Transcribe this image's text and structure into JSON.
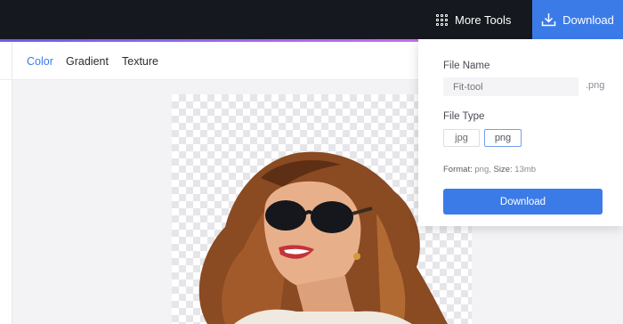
{
  "header": {
    "more_tools_label": "More Tools",
    "download_label": "Download",
    "accent_color": "#3b7be8",
    "dark_color": "#16181f"
  },
  "tabs": [
    {
      "label": "Color",
      "active": true
    },
    {
      "label": "Gradient",
      "active": false
    },
    {
      "label": "Texture",
      "active": false
    }
  ],
  "download_panel": {
    "file_name_label": "File Name",
    "file_name_placeholder": "Fit-tool",
    "extension": ".png",
    "file_type_label": "File Type",
    "file_types": [
      {
        "label": "jpg",
        "selected": false
      },
      {
        "label": "png",
        "selected": true
      }
    ],
    "format_label": "Format:",
    "format_value": "png,",
    "size_label": "Size:",
    "size_value": "13mb",
    "download_button_label": "Download"
  },
  "icons": {
    "more_tools": "grid-icon",
    "download": "download-icon"
  }
}
